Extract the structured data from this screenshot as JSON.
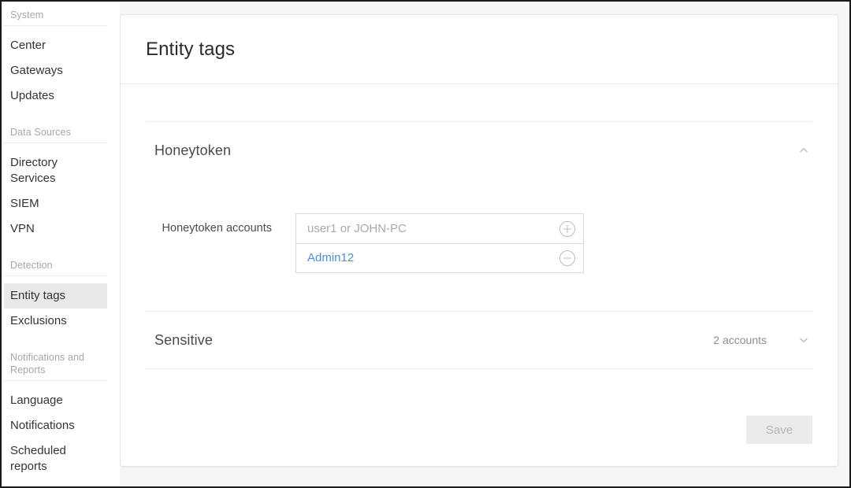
{
  "sidebar": {
    "groups": [
      {
        "label": "System",
        "items": [
          {
            "label": "Center",
            "selected": false
          },
          {
            "label": "Gateways",
            "selected": false
          },
          {
            "label": "Updates",
            "selected": false
          }
        ]
      },
      {
        "label": "Data Sources",
        "items": [
          {
            "label": "Directory Services",
            "selected": false
          },
          {
            "label": "SIEM",
            "selected": false
          },
          {
            "label": "VPN",
            "selected": false
          }
        ]
      },
      {
        "label": "Detection",
        "items": [
          {
            "label": "Entity tags",
            "selected": true
          },
          {
            "label": "Exclusions",
            "selected": false
          }
        ]
      },
      {
        "label": "Notifications and Reports",
        "items": [
          {
            "label": "Language",
            "selected": false
          },
          {
            "label": "Notifications",
            "selected": false
          },
          {
            "label": "Scheduled reports",
            "selected": false
          }
        ]
      }
    ]
  },
  "header": {
    "title": "Entity tags"
  },
  "sections": {
    "honeytoken": {
      "title": "Honeytoken",
      "expanded": true,
      "toggle_icon": "chevron-up-icon",
      "field": {
        "label": "Honeytoken accounts",
        "placeholder": "user1 or JOHN-PC",
        "add_icon": "circle-plus-icon",
        "entries": [
          {
            "value": "Admin12",
            "remove_icon": "circle-minus-icon"
          }
        ]
      }
    },
    "sensitive": {
      "title": "Sensitive",
      "meta": "2 accounts",
      "expanded": false,
      "toggle_icon": "chevron-down-icon"
    }
  },
  "footer": {
    "save_label": "Save",
    "save_enabled": false
  },
  "colors": {
    "accent_link": "#4a90d9",
    "selected_nav_bg": "#e9e9e9",
    "page_bg": "#f6f6f7",
    "card_bg": "#ffffff",
    "muted_text": "#a6a6a6"
  }
}
